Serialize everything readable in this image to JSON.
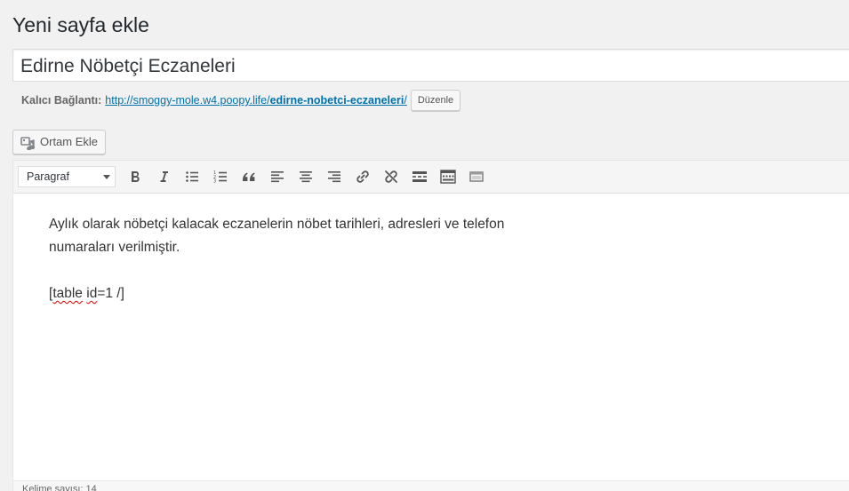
{
  "page": {
    "title": "Yeni sayfa ekle"
  },
  "post": {
    "title_value": "Edirne Nöbetçi Eczaneleri"
  },
  "permalink": {
    "label": "Kalıcı Bağlantı:",
    "url_base": "http://smoggy-mole.w4.poopy.life/",
    "slug": "edirne-nobetci-eczaneleri",
    "url_suffix": "/",
    "edit_button": "Düzenle"
  },
  "media": {
    "add_button": "Ortam Ekle"
  },
  "toolbar": {
    "format_selected": "Paragraf",
    "buttons": [
      {
        "name": "bold",
        "icon": "bold-icon"
      },
      {
        "name": "italic",
        "icon": "italic-icon"
      },
      {
        "name": "bullet-list",
        "icon": "bullet-list-icon"
      },
      {
        "name": "numbered-list",
        "icon": "numbered-list-icon"
      },
      {
        "name": "blockquote",
        "icon": "quote-icon"
      },
      {
        "name": "align-left",
        "icon": "align-left-icon"
      },
      {
        "name": "align-center",
        "icon": "align-center-icon"
      },
      {
        "name": "align-right",
        "icon": "align-right-icon"
      },
      {
        "name": "insert-link",
        "icon": "link-icon"
      },
      {
        "name": "remove-link",
        "icon": "unlink-icon"
      },
      {
        "name": "read-more",
        "icon": "read-more-icon"
      },
      {
        "name": "toolbar-toggle",
        "icon": "toolbar-toggle-icon"
      },
      {
        "name": "fullscreen",
        "icon": "distraction-free-icon"
      }
    ]
  },
  "editor": {
    "paragraph": "Aylık olarak nöbetçi kalacak eczanelerin nöbet tarihleri, adresleri ve telefon numaraları verilmiştir.",
    "shortcode_open": "[",
    "shortcode_word1": "table",
    "shortcode_space": " ",
    "shortcode_word2": "id",
    "shortcode_rest": "=1 /]"
  },
  "status": {
    "word_count": "Kelime sayısı: 14"
  },
  "colors": {
    "link": "#0073aa",
    "background": "#f1f1f1",
    "spell_error": "#dd0000"
  }
}
